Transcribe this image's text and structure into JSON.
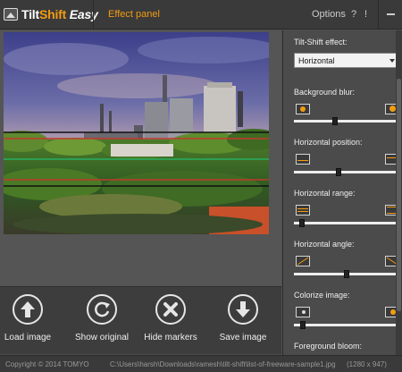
{
  "app": {
    "logo": {
      "tilt": "Tilt",
      "shift": "Shift",
      "easy": "Easy"
    },
    "effect_panel": "Effect panel",
    "options": "Options",
    "help": "?",
    "info": "!"
  },
  "toolbar": {
    "load": "Load image",
    "original": "Show original",
    "hide": "Hide markers",
    "save": "Save image"
  },
  "status": {
    "copyright": "Copyright © 2014 TOMYO",
    "path": "C:\\Users\\harsh\\Downloads\\ramesh\\tilt-shift\\list-of-freeware-sample1.jpg",
    "dimensions": "(1280 x 947)"
  },
  "panel": {
    "effect_label": "Tilt-Shift effect:",
    "effect_value": "Horizontal",
    "bg_blur_label": "Background blur:",
    "bg_blur_value": 0.38,
    "h_position_label": "Horizontal position:",
    "h_position_value": 0.42,
    "h_range_label": "Horizontal range:",
    "h_range_value": 0.05,
    "h_angle_label": "Horizontal angle:",
    "h_angle_value": 0.5,
    "colorize_label": "Colorize image:",
    "colorize_value": 0.06,
    "fg_bloom_label": "Foreground bloom:"
  },
  "colors": {
    "accent": "#f39c12",
    "marker_red": "#c0392b",
    "marker_green": "#27ae60",
    "marker_black": "#111111"
  },
  "icons": [
    "picture-icon",
    "arrow-up-icon",
    "refresh-icon",
    "close-icon",
    "arrow-down-icon"
  ]
}
